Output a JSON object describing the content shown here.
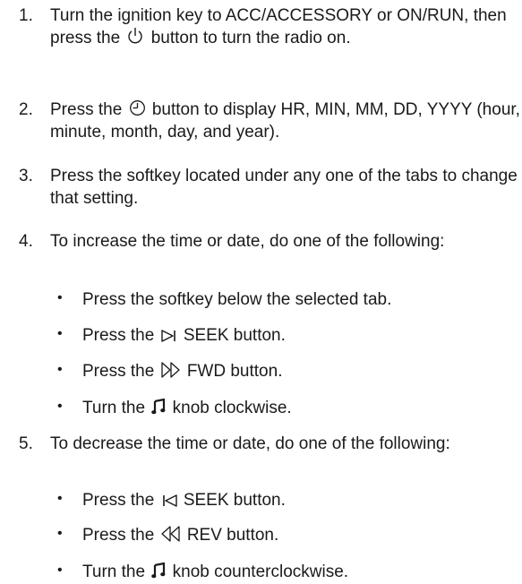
{
  "steps": [
    {
      "number": "1.",
      "before": "Turn the ignition key to ACC/ACCESSORY or ON/RUN, then press the",
      "icon": "power-icon",
      "after": "button to turn the radio on."
    },
    {
      "number": "2.",
      "before": "Press the",
      "icon": "clock-icon",
      "after": "button to display HR, MIN, MM, DD, YYYY (hour, minute, month, day, and year)."
    },
    {
      "number": "3.",
      "text": "Press the softkey located under any one of the tabs to change that setting."
    },
    {
      "number": "4.",
      "text": "To increase the time or date, do one of the following:",
      "bullets": [
        {
          "marker": "•",
          "text": "Press the softkey below the selected tab."
        },
        {
          "marker": "•",
          "before": "Press the",
          "icon": "seek-forward-icon",
          "after": "SEEK button."
        },
        {
          "marker": "•",
          "before": "Press the",
          "icon": "fast-forward-icon",
          "after": "FWD button."
        },
        {
          "marker": "•",
          "before": "Turn the",
          "icon": "music-note-icon",
          "after": "knob clockwise."
        }
      ]
    },
    {
      "number": "5.",
      "text": "To decrease the time or date, do one of the following:",
      "bullets": [
        {
          "marker": "•",
          "before": "Press the",
          "icon": "seek-back-icon",
          "after": "SEEK button."
        },
        {
          "marker": "•",
          "before": "Press the",
          "icon": "rewind-icon",
          "after": "REV button."
        },
        {
          "marker": "•",
          "before": "Turn the",
          "icon": "music-note-icon",
          "after": "knob counterclockwise."
        }
      ]
    }
  ],
  "colors": {
    "text": "#1a1a1a",
    "background": "#ffffff"
  }
}
